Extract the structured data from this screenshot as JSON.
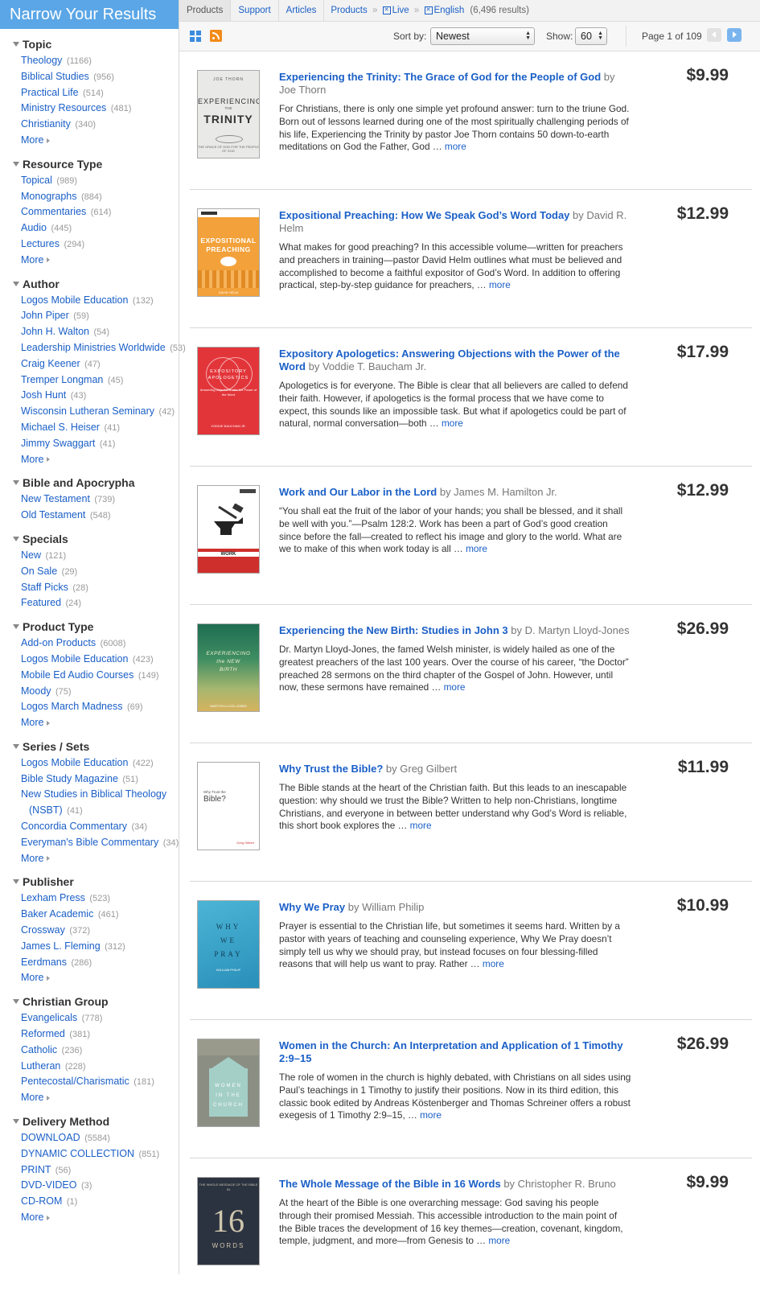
{
  "sidebar": {
    "heading": "Narrow Your Results",
    "more_label": "More",
    "facets": [
      {
        "title": "Topic",
        "items": [
          {
            "label": "Theology",
            "count": "(1166)"
          },
          {
            "label": "Biblical Studies",
            "count": "(956)"
          },
          {
            "label": "Practical Life",
            "count": "(514)"
          },
          {
            "label": "Ministry Resources",
            "count": "(481)"
          },
          {
            "label": "Christianity",
            "count": "(340)"
          }
        ],
        "has_more": true
      },
      {
        "title": "Resource Type",
        "items": [
          {
            "label": "Topical",
            "count": "(989)"
          },
          {
            "label": "Monographs",
            "count": "(884)"
          },
          {
            "label": "Commentaries",
            "count": "(614)"
          },
          {
            "label": "Audio",
            "count": "(445)"
          },
          {
            "label": "Lectures",
            "count": "(294)"
          }
        ],
        "has_more": true
      },
      {
        "title": "Author",
        "items": [
          {
            "label": "Logos Mobile Education",
            "count": "(132)"
          },
          {
            "label": "John Piper",
            "count": "(59)"
          },
          {
            "label": "John H. Walton",
            "count": "(54)"
          },
          {
            "label": "Leadership Ministries Worldwide",
            "count": "(53)"
          },
          {
            "label": "Craig Keener",
            "count": "(47)"
          },
          {
            "label": "Tremper Longman",
            "count": "(45)"
          },
          {
            "label": "Josh Hunt",
            "count": "(43)"
          },
          {
            "label": "Wisconsin Lutheran Seminary",
            "count": "(42)"
          },
          {
            "label": "Michael S. Heiser",
            "count": "(41)"
          },
          {
            "label": "Jimmy Swaggart",
            "count": "(41)"
          }
        ],
        "has_more": true
      },
      {
        "title": "Bible and Apocrypha",
        "items": [
          {
            "label": "New Testament",
            "count": "(739)"
          },
          {
            "label": "Old Testament",
            "count": "(548)"
          }
        ],
        "has_more": false
      },
      {
        "title": "Specials",
        "items": [
          {
            "label": "New",
            "count": "(121)"
          },
          {
            "label": "On Sale",
            "count": "(29)"
          },
          {
            "label": "Staff Picks",
            "count": "(28)"
          },
          {
            "label": "Featured",
            "count": "(24)"
          }
        ],
        "has_more": false
      },
      {
        "title": "Product Type",
        "items": [
          {
            "label": "Add-on Products",
            "count": "(6008)"
          },
          {
            "label": "Logos Mobile Education",
            "count": "(423)"
          },
          {
            "label": "Mobile Ed Audio Courses",
            "count": "(149)"
          },
          {
            "label": "Moody",
            "count": "(75)"
          },
          {
            "label": "Logos March Madness",
            "count": "(69)"
          }
        ],
        "has_more": true
      },
      {
        "title": "Series / Sets",
        "items": [
          {
            "label": "Logos Mobile Education",
            "count": "(422)"
          },
          {
            "label": "Bible Study Magazine",
            "count": "(51)"
          },
          {
            "label": "New Studies in Biblical Theology",
            "count": ""
          },
          {
            "label": "(NSBT)",
            "count": "(41)",
            "indent": true
          },
          {
            "label": "Concordia Commentary",
            "count": "(34)"
          },
          {
            "label": "Everyman's Bible Commentary",
            "count": "(34)"
          }
        ],
        "has_more": true
      },
      {
        "title": "Publisher",
        "items": [
          {
            "label": "Lexham Press",
            "count": "(523)"
          },
          {
            "label": "Baker Academic",
            "count": "(461)"
          },
          {
            "label": "Crossway",
            "count": "(372)"
          },
          {
            "label": "James L. Fleming",
            "count": "(312)"
          },
          {
            "label": "Eerdmans",
            "count": "(286)"
          }
        ],
        "has_more": true
      },
      {
        "title": "Christian Group",
        "items": [
          {
            "label": "Evangelicals",
            "count": "(778)"
          },
          {
            "label": "Reformed",
            "count": "(381)"
          },
          {
            "label": "Catholic",
            "count": "(236)"
          },
          {
            "label": "Lutheran",
            "count": "(228)"
          },
          {
            "label": "Pentecostal/Charismatic",
            "count": "(181)"
          }
        ],
        "has_more": true
      },
      {
        "title": "Delivery Method",
        "items": [
          {
            "label": "DOWNLOAD",
            "count": "(5584)"
          },
          {
            "label": "DYNAMIC COLLECTION",
            "count": "(851)"
          },
          {
            "label": "PRINT",
            "count": "(56)"
          },
          {
            "label": "DVD-VIDEO",
            "count": "(3)"
          },
          {
            "label": "CD-ROM",
            "count": "(1)"
          }
        ],
        "has_more": true
      }
    ]
  },
  "topnav": {
    "tabs": [
      "Products",
      "Support",
      "Articles"
    ],
    "crumb_root": "Products",
    "crumb_sep": "»",
    "filters": [
      "Live",
      "English"
    ],
    "filter_x": "✕",
    "results": "(6,496 results)"
  },
  "toolbar": {
    "sort_label": "Sort by:",
    "sort_value": "Newest",
    "show_label": "Show:",
    "show_value": "60",
    "page_info": "Page 1 of 109"
  },
  "products": [
    {
      "title": "Experiencing the Trinity: The Grace of God for the People of God",
      "by": "by Joe Thorn",
      "desc": "For Christians, there is only one simple yet profound answer: turn to the triune God. Born out of lessons learned during one of the most spiritually challenging periods of his life, Experiencing the Trinity by pastor Joe Thorn contains 50 down-to-earth meditations on God the Father, God …",
      "price": "$9.99",
      "cover": {
        "style": "cv1",
        "author": "JOE THORN",
        "line1": "EXPERIENCING",
        "line2": "THE",
        "line3": "TRINITY",
        "sub": "THE GRACE OF GOD FOR THE PEOPLE OF GOD"
      }
    },
    {
      "title": "Expositional Preaching: How We Speak God’s Word Today",
      "by": "by David R. Helm",
      "desc": "What makes for good preaching? In this accessible volume—written for preachers and preachers in training—pastor David Helm outlines what must be believed and accomplished to become a faithful expositor of God’s Word. In addition to offering practical, step-by-step guidance for preachers, …",
      "price": "$12.99",
      "cover": {
        "style": "cv2",
        "line1": "EXPOSITIONAL",
        "line2": "PREACHING",
        "author": "DAVID HELM"
      }
    },
    {
      "title": "Expository Apologetics: Answering Objections with the Power of the Word",
      "by": "by Voddie T. Baucham Jr.",
      "desc": "Apologetics is for everyone. The Bible is clear that all believers are called to defend their faith. However, if apologetics is the formal process that we have come to expect, this sounds like an impossible task. But what if apologetics could be part of natural, normal conversation—both …",
      "price": "$17.99",
      "cover": {
        "style": "cv3",
        "line1": "EXPOSITORY",
        "line2": "APOLOGETICS",
        "sub": "Answering Objections with the Power of the Word",
        "author": "VODDIE BAUCHAM JR."
      }
    },
    {
      "title": "Work and Our Labor in the Lord",
      "by": "by James M. Hamilton Jr.",
      "desc": "“You shall eat the fruit of the labor of your hands; you shall be blessed, and it shall be well with you.”—Psalm 128:2. Work has been a part of God’s good creation since before the fall—created to reflect his image and glory to the world. What are we to make of this when work today is all …",
      "price": "$12.99",
      "cover": {
        "style": "cv4",
        "line1": "WORK"
      }
    },
    {
      "title": "Experiencing the New Birth: Studies in John 3",
      "by": "by D. Martyn Lloyd-Jones",
      "desc": "Dr. Martyn Lloyd-Jones, the famed Welsh minister, is widely hailed as one of the greatest preachers of the last 100 years. Over the course of his career, “the Doctor” preached 28 sermons on the third chapter of the Gospel of John. However, until now, these sermons have remained …",
      "price": "$26.99",
      "cover": {
        "style": "cv5",
        "line1": "EXPERIENCING",
        "line2": "the NEW",
        "line3": "BIRTH",
        "author": "MARTYN LLOYD-JONES"
      }
    },
    {
      "title": "Why Trust the Bible?",
      "by": "by Greg Gilbert",
      "desc": "The Bible stands at the heart of the Christian faith. But this leads to an inescapable question: why should we trust the Bible? Written to help non-Christians, longtime Christians, and everyone in between better understand why God’s Word is reliable, this short book explores the …",
      "price": "$11.99",
      "cover": {
        "style": "cv6",
        "line1": "Why Trust the",
        "line2": "Bible?",
        "author": "Greg Gilbert"
      }
    },
    {
      "title": "Why We Pray",
      "by": "by William Philip",
      "desc": "Prayer is essential to the Christian life, but sometimes it seems hard. Written by a pastor with years of teaching and counseling experience, Why We Pray doesn’t simply tell us why we should pray, but instead focuses on four blessing-filled reasons that will help us want to pray. Rather …",
      "price": "$10.99",
      "cover": {
        "style": "cv7",
        "line1": "WHY",
        "line2": "WE",
        "line3": "PRAY",
        "author": "WILLIAM PHILIP"
      }
    },
    {
      "title": "Women in the Church: An Interpretation and Application of 1 Timothy 2:9–15",
      "by": "",
      "desc": "The role of women in the church is highly debated, with Christians on all sides using Paul’s teachings in 1 Timothy to justify their positions. Now in its third edition, this classic book edited by Andreas Köstenberger and Thomas Schreiner offers a robust exegesis of 1 Timothy 2:9–15, …",
      "price": "$26.99",
      "cover": {
        "style": "cv8",
        "line1": "WOMEN",
        "line2": "IN THE",
        "line3": "CHURCH"
      }
    },
    {
      "title": "The Whole Message of the Bible in 16 Words",
      "by": "by Christopher R. Bruno",
      "desc": "At the heart of the Bible is one overarching message: God saving his people through their promised Messiah. This accessible introduction to the main point of the Bible traces the development of 16 key themes—creation, covenant, kingdom, temple, judgment, and more—from Genesis to …",
      "price": "$9.99",
      "cover": {
        "style": "cv9",
        "line1": "THE WHOLE MESSAGE OF THE BIBLE IN",
        "line2": "16",
        "line3": "WORDS"
      }
    }
  ],
  "more_text": "more"
}
